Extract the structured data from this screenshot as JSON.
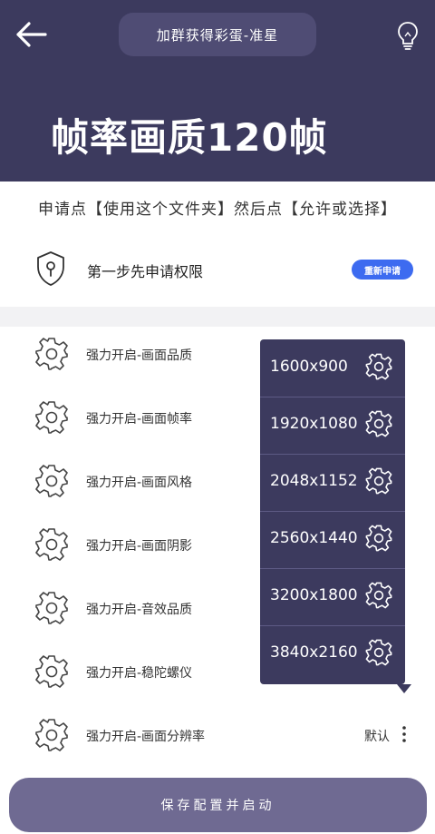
{
  "header": {
    "title_pill": "加群获得彩蛋-准星",
    "big_title": "帧率画质120帧",
    "back_icon": "arrow-left-icon",
    "tip_icon": "lightbulb-icon"
  },
  "instruction": "申请点【使用这个文件夹】然后点【允许或选择】",
  "permission": {
    "label": "第一步先申请权限",
    "button": "重新申请",
    "icon": "shield-lock-icon"
  },
  "options": [
    {
      "label": "强力开启-画面品质"
    },
    {
      "label": "强力开启-画面帧率"
    },
    {
      "label": "强力开启-画面风格"
    },
    {
      "label": "强力开启-画面阴影"
    },
    {
      "label": "强力开启-音效品质"
    },
    {
      "label": "强力开启-稳陀螺仪"
    },
    {
      "label": "强力开启-画面分辨率",
      "value": "默认"
    }
  ],
  "resolution_menu": [
    "1600x900",
    "1920x1080",
    "2048x1152",
    "2560x1440",
    "3200x1800",
    "3840x2160"
  ],
  "save_button": "保存配置并启动",
  "colors": {
    "header_bg": "#3c3a5e",
    "accent_blue": "#3d6bf0",
    "save_bg": "#6f6a92"
  }
}
